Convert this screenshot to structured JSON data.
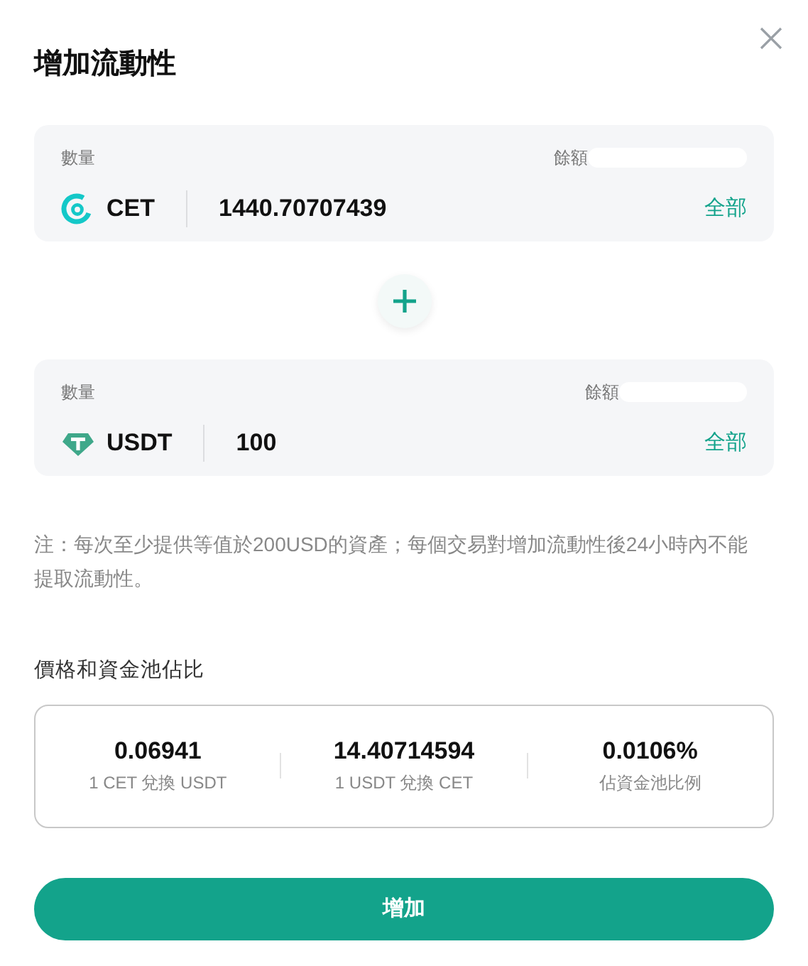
{
  "dialog": {
    "title": "增加流動性"
  },
  "inputs": [
    {
      "label": "數量",
      "balance_label": "餘額",
      "token": "CET",
      "kind": "cet",
      "value": "1440.70707439",
      "max_button": "全部"
    },
    {
      "label": "數量",
      "balance_label": "餘額",
      "token": "USDT",
      "kind": "usdt",
      "value": "100",
      "max_button": "全部"
    }
  ],
  "note": "注：每次至少提供等值於200USD的資產；每個交易對增加流動性後24小時內不能提取流動性。",
  "stats_title": "價格和資金池佔比",
  "stats": [
    {
      "value": "0.06941",
      "caption": "1 CET 兌換 USDT"
    },
    {
      "value": "14.40714594",
      "caption": "1 USDT 兌換 CET"
    },
    {
      "value": "0.0106%",
      "caption": "佔資金池比例"
    }
  ],
  "submit": "增加"
}
